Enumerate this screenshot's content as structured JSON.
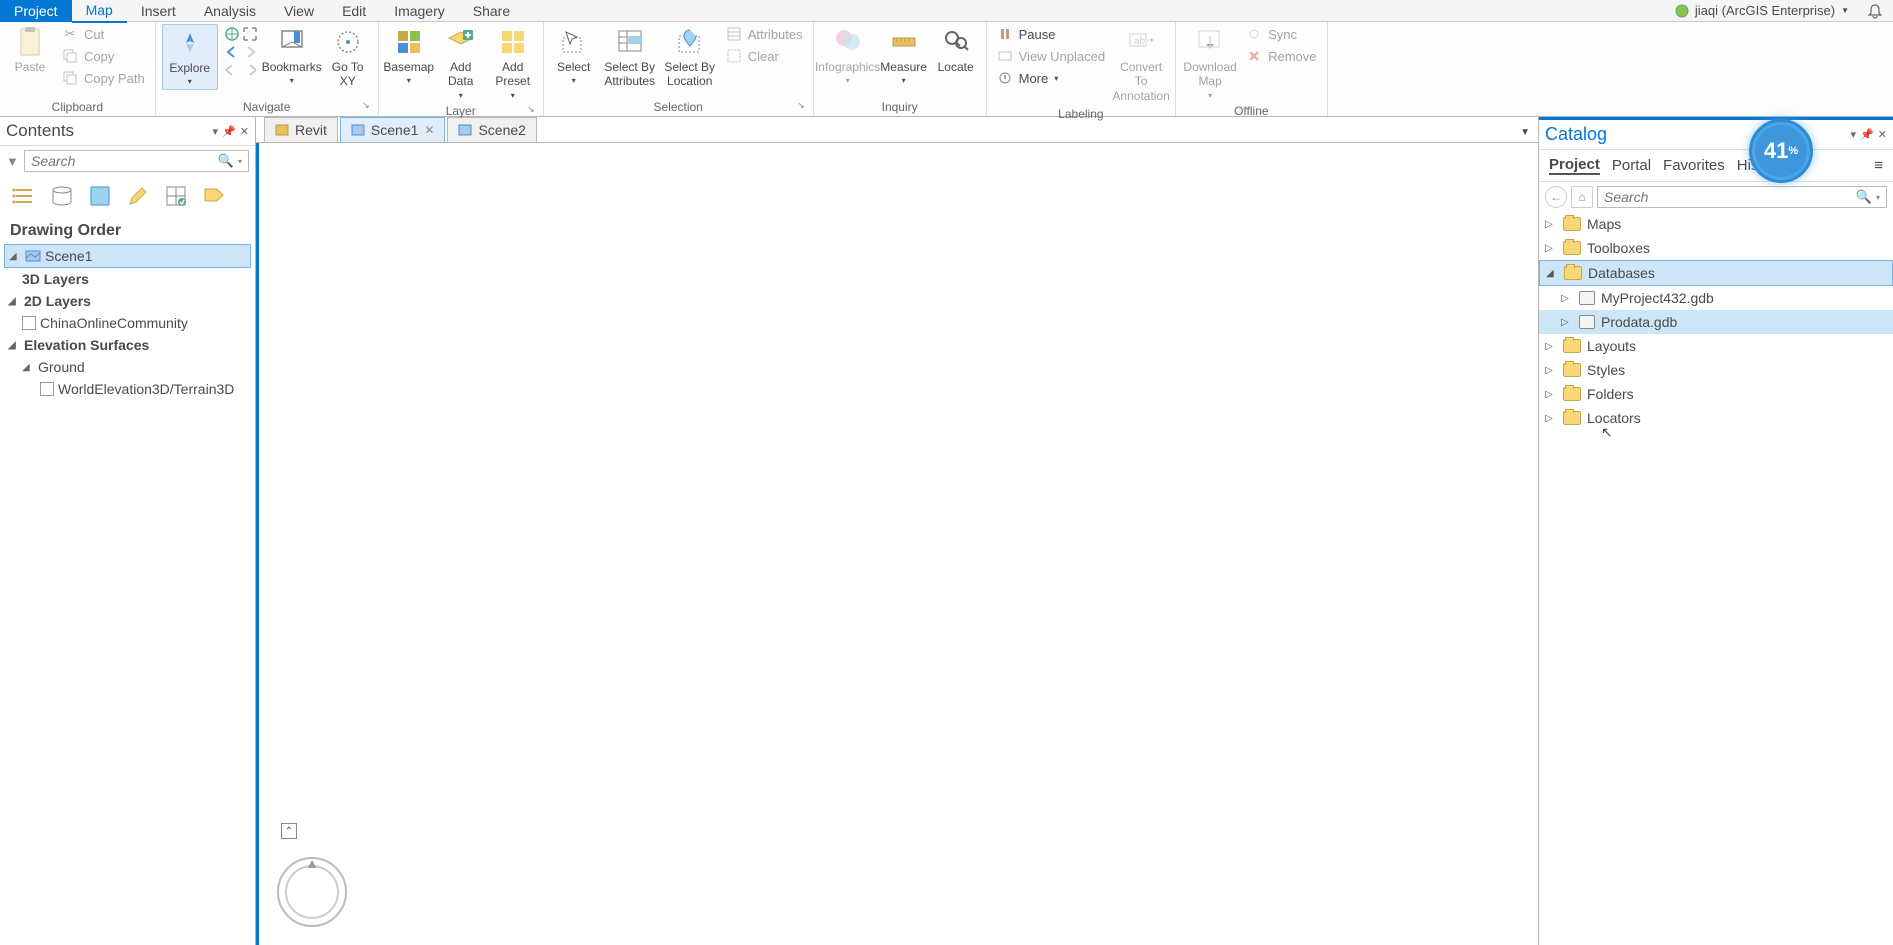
{
  "menubar": {
    "items": [
      "Project",
      "Map",
      "Insert",
      "Analysis",
      "View",
      "Edit",
      "Imagery",
      "Share"
    ],
    "user": "jiaqi (ArcGIS Enterprise)"
  },
  "ribbon": {
    "clipboard": {
      "label": "Clipboard",
      "paste": "Paste",
      "cut": "Cut",
      "copy": "Copy",
      "copy_path": "Copy Path"
    },
    "navigate": {
      "label": "Navigate",
      "explore": "Explore",
      "bookmarks": "Bookmarks",
      "go_to_xy": "Go To XY"
    },
    "layer": {
      "label": "Layer",
      "basemap": "Basemap",
      "add_data": "Add Data",
      "add_preset": "Add Preset"
    },
    "selection": {
      "label": "Selection",
      "select": "Select",
      "select_by_attributes": "Select By Attributes",
      "select_by_location": "Select By Location",
      "attributes": "Attributes",
      "clear": "Clear"
    },
    "inquiry": {
      "label": "Inquiry",
      "infographics": "Infographics",
      "measure": "Measure",
      "locate": "Locate"
    },
    "labeling": {
      "label": "Labeling",
      "pause": "Pause",
      "view_unplaced": "View Unplaced",
      "more": "More",
      "convert": "Convert To Annotation"
    },
    "offline": {
      "label": "Offline",
      "download_map": "Download Map",
      "sync": "Sync",
      "remove": "Remove"
    }
  },
  "contents": {
    "title": "Contents",
    "search_placeholder": "Search",
    "section": "Drawing Order",
    "active_scene": "Scene1",
    "layers_3d": "3D Layers",
    "layers_2d": "2D Layers",
    "china_layer": "ChinaOnlineCommunity",
    "elev_surfaces": "Elevation Surfaces",
    "ground": "Ground",
    "world_elev": "WorldElevation3D/Terrain3D"
  },
  "view_tabs": [
    "Revit",
    "Scene1",
    "Scene2"
  ],
  "catalog": {
    "title": "Catalog",
    "tabs": [
      "Project",
      "Portal",
      "Favorites",
      "History"
    ],
    "search_placeholder": "Search",
    "tree": {
      "maps": "Maps",
      "toolboxes": "Toolboxes",
      "databases": "Databases",
      "db_items": [
        "MyProject432.gdb",
        "Prodata.gdb"
      ],
      "layouts": "Layouts",
      "styles": "Styles",
      "folders": "Folders",
      "locators": "Locators"
    }
  },
  "progress": "41"
}
